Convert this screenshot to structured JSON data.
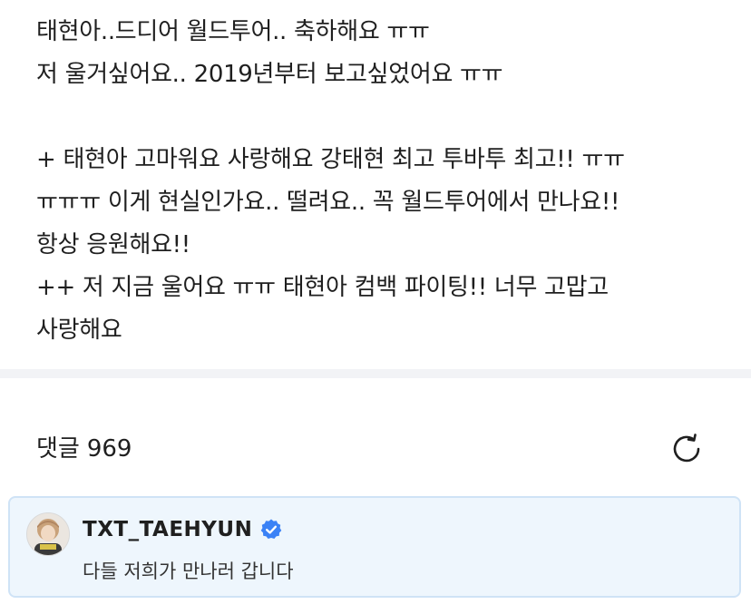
{
  "post": {
    "lines": [
      "태현아..드디어 월드투어.. 축하해요 ㅠㅠ",
      "저 울거싶어요.. 2019년부터 보고싶었어요 ㅠㅠ",
      "",
      "+ 태현아 고마워요 사랑해요 강태현 최고 투바투 최고!! ㅠㅠ",
      "ㅠㅠㅠ 이게 현실인가요.. 떨려요.. 꼭 월드투어에서 만나요!!",
      "항상 응원해요!!",
      "++ 저 지금 울어요 ㅠㅠ 태현아 컴백 파이팅!! 너무 고맙고",
      "사랑해요"
    ]
  },
  "comments": {
    "label": "댓글",
    "count": "969",
    "refresh_icon": "refresh-icon"
  },
  "pinned_comment": {
    "author": "TXT_TAEHYUN",
    "verified_icon": "verified-badge-icon",
    "verified_color": "#3b82f6",
    "text": "다들 저희가 만나러 갑니다",
    "card_background": "#eef6fd",
    "card_border": "#cfe3f6"
  }
}
